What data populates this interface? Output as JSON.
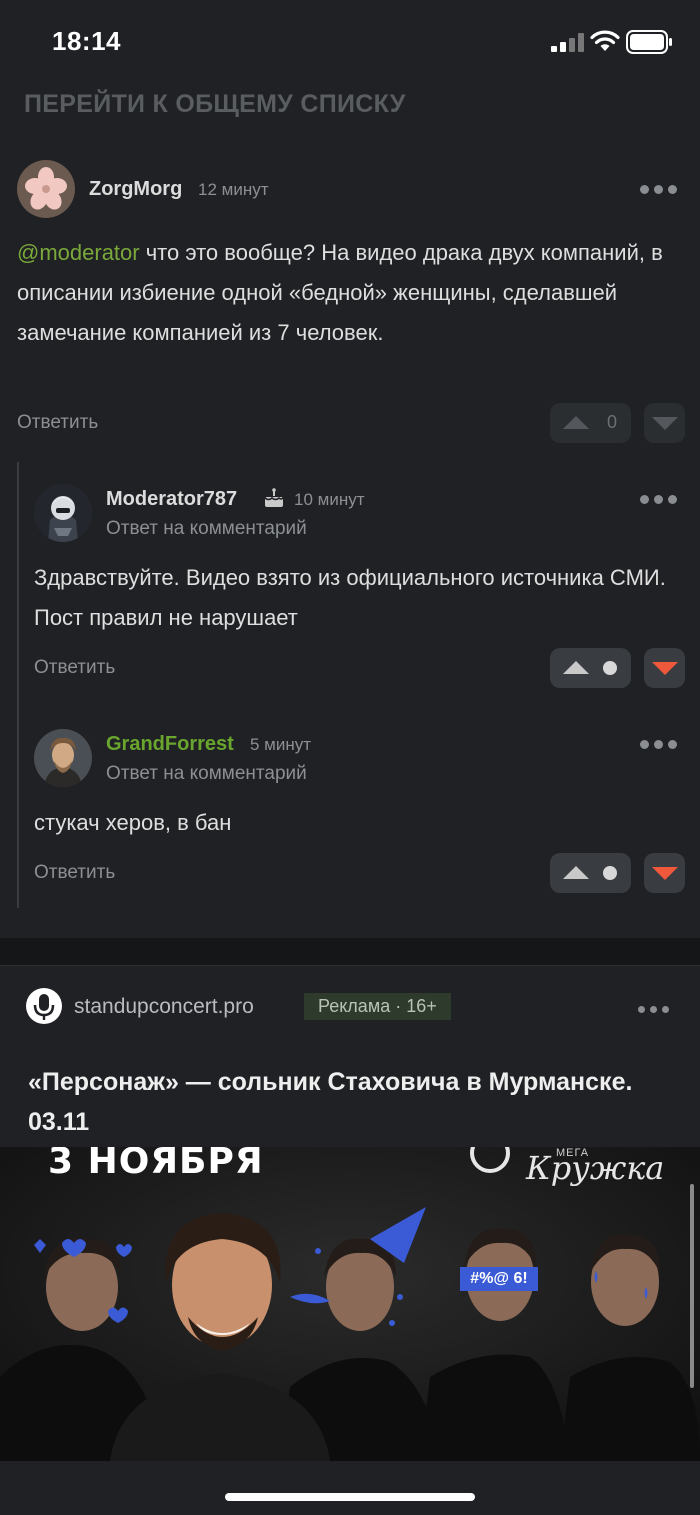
{
  "status_bar": {
    "time": "18:14"
  },
  "nav": {
    "back_label": "ПЕРЕЙТИ К ОБЩЕМУ СПИСКУ"
  },
  "comments": [
    {
      "author": "ZorgMorg",
      "time": "12 минут",
      "mention": "@moderator",
      "text": " что это вообще? На видео драка двух компаний, в описании избиение одной «бедной» женщины, сделавшей замечание компанией из 7 человек.",
      "reply_label": "Ответить",
      "rating": "0"
    },
    {
      "author": "Moderator787",
      "time": "10 минут",
      "subline": "Ответ на комментарий",
      "text": "Здравствуйте. Видео взято из официального источника СМИ. Пост правил не нарушает",
      "reply_label": "Ответить"
    },
    {
      "author": "GrandForrest",
      "author_color": "#6aa52e",
      "time": "5 минут",
      "subline": "Ответ на комментарий",
      "text": "стукач херов, в бан",
      "reply_label": "Ответить"
    }
  ],
  "ad": {
    "domain": "standupconcert.pro",
    "badge": "Реклама · 16+",
    "title": "«Персонаж» — сольник Стаховича в Мурманске. 03.11",
    "banner_date": "3 НОЯБРЯ",
    "banner_brand_small": "МЕГА",
    "banner_brand": "Кружка",
    "banner_tag": "#%@ 6!"
  },
  "icons": {
    "signal": "signal-icon",
    "wifi": "wifi-icon",
    "battery": "battery-icon",
    "more": "more-dots-icon",
    "cake": "cake-icon",
    "upvote": "upvote-arrow-icon",
    "downvote": "downvote-arrow-icon",
    "mic": "microphone-icon"
  },
  "colors": {
    "accent_green": "#7aa83a",
    "downvote_red": "#f0583c",
    "background": "#1f2124"
  }
}
